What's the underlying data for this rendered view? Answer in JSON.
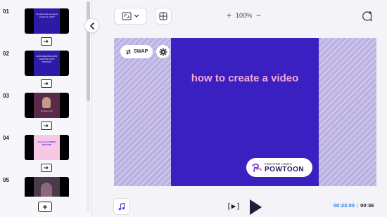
{
  "sidebar": {
    "slides": [
      {
        "number": "01",
        "text": "It's about time someone crushed it, right?",
        "bg": "#2d1aa8"
      },
      {
        "number": "02",
        "text": "HOW AMAZING HOW AMAZING HOW AMAZING",
        "bg": "#2d1aa8"
      },
      {
        "number": "03",
        "text": "Drunken Die",
        "bg": "#5a2a4a"
      },
      {
        "number": "04",
        "text": "Gonna go ABOVE BEYOND",
        "bg": "#f6c8e6"
      },
      {
        "number": "05",
        "text": "",
        "bg": "#4a3a4a"
      }
    ]
  },
  "toolbar": {
    "zoom_plus": "+",
    "zoom_level": "100%",
    "zoom_minus": "−"
  },
  "canvas": {
    "headline": "how to create a video",
    "swap_label": "SWAP",
    "badge_small": "CREATED USING",
    "badge_brand": "POWTOON",
    "stage_color": "#3a1fc1",
    "headline_color": "#f8a8d8"
  },
  "playback": {
    "preview_label": "[▶]",
    "current_time": "00:23:00",
    "separator": "|",
    "total_time": "00:36"
  },
  "icons": {
    "collapse": "chevron-left-icon",
    "aspect": "aspect-ratio-icon",
    "grid": "grid-icon",
    "comment": "add-comment-icon",
    "swap": "swap-icon",
    "gear": "gear-icon",
    "music": "music-note-icon",
    "play": "play-icon",
    "add": "add-slide-icon"
  }
}
